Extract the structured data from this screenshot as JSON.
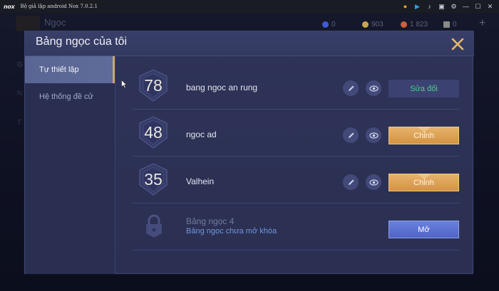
{
  "window": {
    "logo": "nox",
    "title": "Bộ giả lập android Nox 7.0.2.1",
    "icons": [
      "coin-icon",
      "play-store-icon",
      "mic-icon",
      "picture-icon",
      "gear-icon",
      "minimize-icon",
      "maximize-icon",
      "close-icon"
    ]
  },
  "background": {
    "title": "Ngọc",
    "left_items": [
      "G",
      "N",
      "T"
    ],
    "resources": [
      {
        "icon": "gem-icon",
        "value": "0",
        "color": "#3d5bd9"
      },
      {
        "icon": "gold-icon",
        "value": "903",
        "color": "#c9a64a"
      },
      {
        "icon": "voucher-icon",
        "value": "1 823",
        "color": "#d0603a"
      },
      {
        "icon": "ticket-icon",
        "value": "0",
        "color": "#8a8a8a"
      }
    ],
    "plus": "+"
  },
  "dialog": {
    "title": "Bảng ngọc của tôi",
    "sidebar": [
      {
        "label": "Tự thiết lập",
        "active": true
      },
      {
        "label": "Hệ thống đề cử",
        "active": false
      }
    ],
    "rows": [
      {
        "level": "78",
        "name": "bang ngoc an rung",
        "action": "Sửa đổi",
        "style": "edit"
      },
      {
        "level": "48",
        "name": "ngoc ad",
        "action": "Chỉnh",
        "style": "gold"
      },
      {
        "level": "35",
        "name": "Valhein",
        "action": "Chỉnh",
        "style": "gold"
      }
    ],
    "locked": {
      "name": "Bảng ngọc 4",
      "status": "Bảng ngọc chưa mở khóa",
      "action": "Mở"
    }
  },
  "colors": {
    "accent_gold": "#d3913f",
    "accent_green": "#4cd08a",
    "accent_blue": "#4f63c4",
    "dialog_bg": "#2e3358"
  }
}
